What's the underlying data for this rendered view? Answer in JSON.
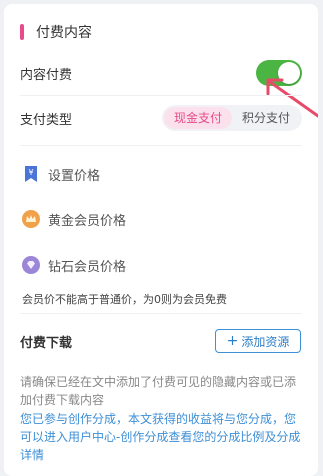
{
  "section": {
    "title": "付费内容"
  },
  "paid_content": {
    "label": "内容付费",
    "enabled": true
  },
  "payment_type": {
    "label": "支付类型",
    "options": [
      "现金支付",
      "积分支付"
    ],
    "selected": "现金支付"
  },
  "prices": [
    {
      "label": "设置价格",
      "icon": "yen-tag-icon"
    },
    {
      "label": "黄金会员价格",
      "icon": "gold-crown-icon"
    },
    {
      "label": "钻石会员价格",
      "icon": "diamond-icon"
    }
  ],
  "member_note": "会员价不能高于普通价，为0则为会员免费",
  "download": {
    "title": "付费下载",
    "add_button": "添加资源",
    "hint": "请确保已经在文中添加了付费可见的隐藏内容或已添加付费下载内容"
  },
  "revenue_info": "您已参与创作分成，本文获得的收益将与您分成，您可以进入用户中心-创作分成查看您的分成比例及分成详情",
  "colors": {
    "accent": "#e84a8a",
    "toggle_on": "#4bb543",
    "link": "#3d8fd6"
  }
}
